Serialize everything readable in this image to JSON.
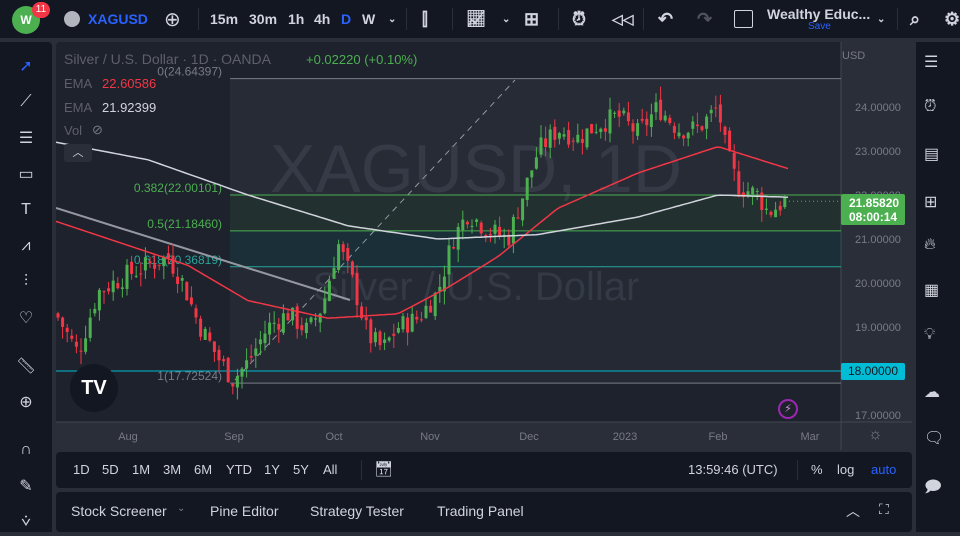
{
  "header": {
    "notifications": "11",
    "symbol": "XAGUSD",
    "intervals": [
      "15m",
      "30m",
      "1h",
      "4h",
      "D",
      "W"
    ],
    "active_interval": "D",
    "layout_name": "Wealthy Educ...",
    "save_label": "Save"
  },
  "legend": {
    "title": "Silver / U.S. Dollar · 1D · OANDA",
    "change": "+0.02220 (+0.10%)",
    "ema1_label": "EMA",
    "ema1_value": "22.60586",
    "ema2_label": "EMA",
    "ema2_value": "21.92399",
    "vol_label": "Vol"
  },
  "watermark": {
    "symbol": "XAGUSD, 1D",
    "name": "Silver / U.S. Dollar"
  },
  "fib": {
    "levels": [
      {
        "ratio": 0,
        "label": "0(24.64397)",
        "price": 24.64397
      },
      {
        "ratio": 0.382,
        "label": "0.382(22.00101)",
        "price": 22.00101
      },
      {
        "ratio": 0.5,
        "label": "0.5(21.18460)",
        "price": 21.1846
      },
      {
        "ratio": 0.618,
        "label": "0.618(20.36819)",
        "price": 20.36819
      },
      {
        "ratio": 1,
        "label": "1(17.72524)",
        "price": 17.72524
      }
    ]
  },
  "price_axis": {
    "currency": "USD",
    "ticks": [
      "24.00000",
      "23.00000",
      "22.00000",
      "21.00000",
      "20.00000",
      "19.00000",
      "18.00000",
      "17.00000"
    ],
    "current_price": "21.85820",
    "countdown": "08:00:14",
    "hline_label": "18.00000"
  },
  "time_axis": {
    "ticks": [
      "Aug",
      "Sep",
      "Oct",
      "Nov",
      "Dec",
      "2023",
      "Feb",
      "Mar"
    ]
  },
  "bottom": {
    "ranges": [
      "1D",
      "5D",
      "1M",
      "3M",
      "6M",
      "YTD",
      "1Y",
      "5Y",
      "All"
    ],
    "clock": "13:59:46 (UTC)",
    "percent": "%",
    "log": "log",
    "auto": "auto"
  },
  "panels": {
    "items": [
      "Stock Screener",
      "Pine Editor",
      "Strategy Tester",
      "Trading Panel"
    ]
  },
  "colors": {
    "up": "#4caf50",
    "down": "#f23645",
    "accent": "#2962ff",
    "ema_red": "#f23645",
    "ema_white": "#d1d4dc",
    "hline": "#00bcd4"
  },
  "chart_data": {
    "type": "candlestick",
    "ylim": [
      16.8,
      25.2
    ],
    "closes_anchor": [
      [
        0,
        19.3
      ],
      [
        22,
        18.4
      ],
      [
        42,
        19.8
      ],
      [
        72,
        20.2
      ],
      [
        92,
        20.4
      ],
      [
        112,
        20.6
      ],
      [
        127,
        20.0
      ],
      [
        142,
        19.1
      ],
      [
        162,
        18.3
      ],
      [
        177,
        17.8
      ],
      [
        192,
        18.2
      ],
      [
        212,
        19.0
      ],
      [
        232,
        19.3
      ],
      [
        252,
        18.9
      ],
      [
        267,
        19.5
      ],
      [
        282,
        20.9
      ],
      [
        297,
        20.0
      ],
      [
        312,
        18.8
      ],
      [
        327,
        18.5
      ],
      [
        342,
        19.0
      ],
      [
        362,
        19.2
      ],
      [
        382,
        19.8
      ],
      [
        397,
        21.0
      ],
      [
        412,
        21.6
      ],
      [
        432,
        21.2
      ],
      [
        452,
        21.0
      ],
      [
        467,
        22.0
      ],
      [
        482,
        23.0
      ],
      [
        502,
        23.5
      ],
      [
        522,
        23.3
      ],
      [
        542,
        23.6
      ],
      [
        562,
        23.8
      ],
      [
        582,
        23.4
      ],
      [
        602,
        24.0
      ],
      [
        622,
        23.5
      ],
      [
        642,
        23.5
      ],
      [
        662,
        24.0
      ],
      [
        670,
        23.0
      ],
      [
        682,
        22.2
      ],
      [
        702,
        22.0
      ],
      [
        712,
        21.6
      ],
      [
        729,
        21.86
      ]
    ],
    "ema_red": [
      [
        0,
        21.4
      ],
      [
        132,
        20.4
      ],
      [
        192,
        19.6
      ],
      [
        272,
        19.2
      ],
      [
        342,
        19.3
      ],
      [
        392,
        19.9
      ],
      [
        442,
        20.6
      ],
      [
        502,
        21.7
      ],
      [
        582,
        22.5
      ],
      [
        662,
        23.1
      ],
      [
        732,
        22.6
      ]
    ],
    "ema_white": [
      [
        0,
        23.2
      ],
      [
        92,
        22.8
      ],
      [
        192,
        22.0
      ],
      [
        292,
        21.3
      ],
      [
        382,
        21.0
      ],
      [
        482,
        21.1
      ],
      [
        582,
        21.5
      ],
      [
        662,
        22.0
      ],
      [
        732,
        21.95
      ]
    ]
  }
}
